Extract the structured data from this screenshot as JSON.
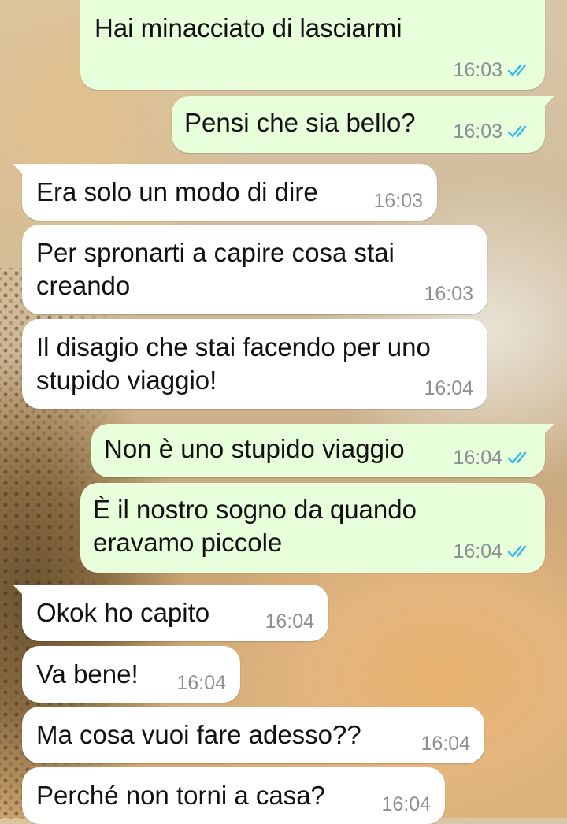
{
  "colors": {
    "incoming_bubble": "#ffffff",
    "outgoing_bubble": "#e7ffdb",
    "read_ticks": "#34b7f1",
    "timestamp": "#8b8f93"
  },
  "messages": [
    {
      "direction": "out",
      "text": "Hai minacciato di lasciarmi",
      "time": "16:03",
      "status": "read"
    },
    {
      "direction": "out",
      "text": "Pensi che sia bello?",
      "time": "16:03",
      "status": "read"
    },
    {
      "direction": "in",
      "text": "Era solo un modo di dire",
      "time": "16:03"
    },
    {
      "direction": "in",
      "line1": "Per spronarti a capire cosa stai",
      "line2": "creando",
      "time": "16:03"
    },
    {
      "direction": "in",
      "line1": "Il disagio che stai facendo per uno",
      "line2": "stupido viaggio!",
      "time": "16:04"
    },
    {
      "direction": "out",
      "text": "Non è uno stupido viaggio",
      "time": "16:04",
      "status": "read"
    },
    {
      "direction": "out",
      "line1": "È il nostro sogno da quando",
      "line2": "eravamo piccole",
      "time": "16:04",
      "status": "read"
    },
    {
      "direction": "in",
      "text": "Okok ho capito",
      "time": "16:04"
    },
    {
      "direction": "in",
      "text": "Va bene!",
      "time": "16:04"
    },
    {
      "direction": "in",
      "text": "Ma cosa vuoi fare adesso??",
      "time": "16:04"
    },
    {
      "direction": "in",
      "text": "Perché non torni a casa?",
      "time": "16:04"
    }
  ]
}
